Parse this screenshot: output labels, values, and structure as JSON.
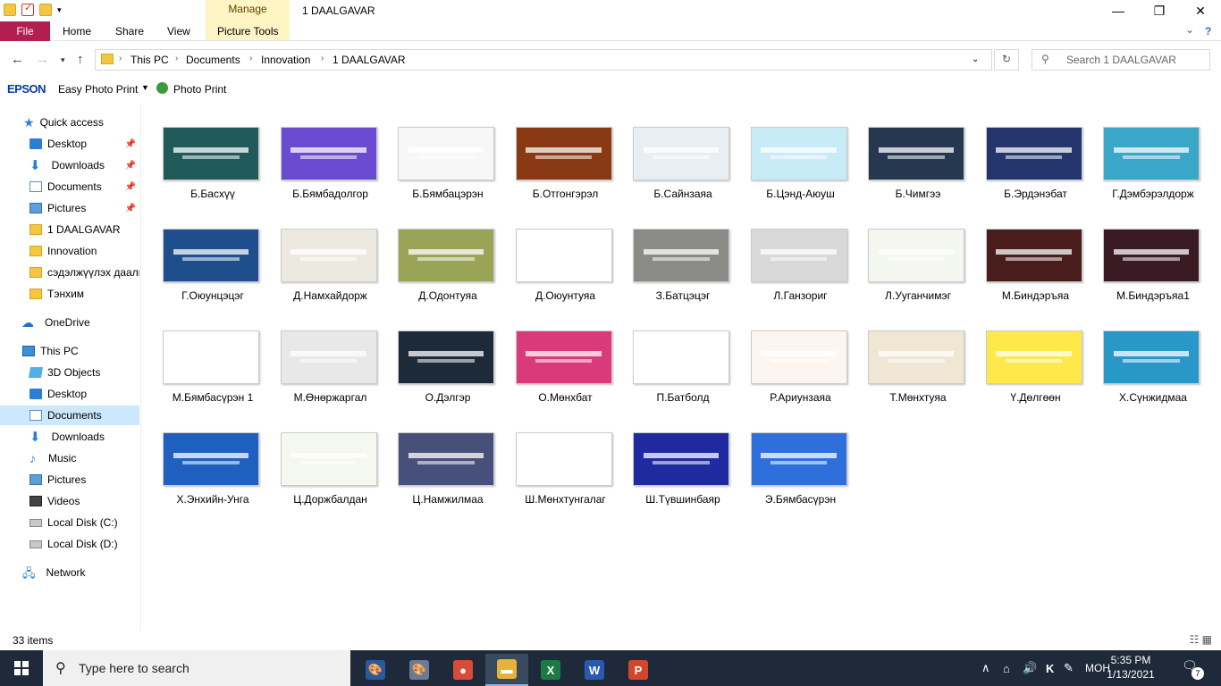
{
  "titlebar": {
    "title": "1 DAALGAVAR",
    "manage_tab": "Manage",
    "minimize": "—",
    "maximize": "❐",
    "close": "✕"
  },
  "ribbon": {
    "tabs": [
      "File",
      "Home",
      "Share",
      "View",
      "Picture Tools"
    ],
    "expand": "⌄",
    "help": "?"
  },
  "address": {
    "crumbs": [
      "This PC",
      "Documents",
      "Innovation",
      "1 DAALGAVAR"
    ],
    "search_placeholder": "Search 1 DAALGAVAR"
  },
  "epson": {
    "brand": "EPSON",
    "easy_photo_print": "Easy Photo Print",
    "photo_print": "Photo Print"
  },
  "sidebar": {
    "items": [
      {
        "label": "Quick access",
        "icon": "star-icon"
      },
      {
        "label": "Desktop",
        "icon": "desktop-icon",
        "pinned": true
      },
      {
        "label": "Downloads",
        "icon": "download-icon",
        "pinned": true
      },
      {
        "label": "Documents",
        "icon": "documents-icon",
        "pinned": true
      },
      {
        "label": "Pictures",
        "icon": "pictures-icon",
        "pinned": true
      },
      {
        "label": "1 DAALGAVAR",
        "icon": "folder-icon"
      },
      {
        "label": "Innovation",
        "icon": "folder-icon"
      },
      {
        "label": "сэдэлжүүлэх даалг",
        "icon": "folder-icon"
      },
      {
        "label": "Тэнхим",
        "icon": "folder-icon"
      },
      {
        "label": "OneDrive",
        "icon": "cloud-icon"
      },
      {
        "label": "This PC",
        "icon": "computer-icon"
      },
      {
        "label": "3D Objects",
        "icon": "3d-objects-icon"
      },
      {
        "label": "Desktop",
        "icon": "desktop-icon"
      },
      {
        "label": "Documents",
        "icon": "documents-icon",
        "selected": true
      },
      {
        "label": "Downloads",
        "icon": "download-icon"
      },
      {
        "label": "Music",
        "icon": "music-icon"
      },
      {
        "label": "Pictures",
        "icon": "pictures-icon"
      },
      {
        "label": "Videos",
        "icon": "video-icon"
      },
      {
        "label": "Local Disk (C:)",
        "icon": "disk-icon"
      },
      {
        "label": "Local Disk (D:)",
        "icon": "disk-icon"
      },
      {
        "label": "Network",
        "icon": "network-icon"
      }
    ]
  },
  "files": [
    {
      "name": "Б.Басхүү",
      "color": "#1f5a58"
    },
    {
      "name": "Б.Бямбадолгор",
      "color": "#6a4bd0"
    },
    {
      "name": "Б.Бямбацэрэн",
      "color": "#f7f7f7"
    },
    {
      "name": "Б.Отгонгэрэл",
      "color": "#8a3a12"
    },
    {
      "name": "Б.Сайнзаяа",
      "color": "#e8eef2"
    },
    {
      "name": "Б.Цэнд-Аюуш",
      "color": "#c7ecf7"
    },
    {
      "name": "Б.Чимгээ",
      "color": "#26384f"
    },
    {
      "name": "Б.Эрдэнэбат",
      "color": "#24356e"
    },
    {
      "name": "Г.Дэмбэрэлдорж",
      "color": "#3aa6c8"
    },
    {
      "name": "Г.Оюунцэцэг",
      "color": "#1e4f8c"
    },
    {
      "name": "Д.Намхайдорж",
      "color": "#eceae0"
    },
    {
      "name": "Д.Одонтуяа",
      "color": "#9aa456"
    },
    {
      "name": "Д.Оюунтуяа",
      "color": "#ffffff"
    },
    {
      "name": "З.Батцэцэг",
      "color": "#8a8a86"
    },
    {
      "name": "Л.Ганзориг",
      "color": "#d8d8d8"
    },
    {
      "name": "Л.Ууганчимэг",
      "color": "#f3f7f0"
    },
    {
      "name": "М.Биндэръяа",
      "color": "#4a1d1d"
    },
    {
      "name": "М.Биндэръяа1",
      "color": "#3a1b24"
    },
    {
      "name": "М.Бямбасүрэн 1",
      "color": "#ffffff"
    },
    {
      "name": "М.Өнөржаргал",
      "color": "#e8e8e8"
    },
    {
      "name": "О.Дэлгэр",
      "color": "#1d2a3a"
    },
    {
      "name": "О.Мөнхбат",
      "color": "#d83a7a"
    },
    {
      "name": "П.Батболд",
      "color": "#ffffff"
    },
    {
      "name": "Р.Ариунзаяа",
      "color": "#fdf6f0"
    },
    {
      "name": "Т.Мөнхтуяа",
      "color": "#efe6d4"
    },
    {
      "name": "Ү.Дөлгөөн",
      "color": "#ffe84a"
    },
    {
      "name": "Х.Сүнжидмаа",
      "color": "#2a97c9"
    },
    {
      "name": "Х.Энхийн-Унга",
      "color": "#1e5fbf"
    },
    {
      "name": "Ц.Доржбалдан",
      "color": "#f4f8ee"
    },
    {
      "name": "Ц.Намжилмаа",
      "color": "#47507a"
    },
    {
      "name": "Ш.Мөнхтунгалаг",
      "color": "#ffffff"
    },
    {
      "name": "Ш.Түвшинбаяр",
      "color": "#1f2aa0"
    },
    {
      "name": "Э.Бямбасүрэн",
      "color": "#2e6fdc"
    }
  ],
  "status": {
    "count": "33 items",
    "views": "☷ ▦"
  },
  "taskbar": {
    "search_placeholder": "Type here to search",
    "apps": [
      {
        "name": "paint-app-icon",
        "glyph": "🎨",
        "color": "#2a5a9c",
        "active": false
      },
      {
        "name": "palette-app-icon",
        "glyph": "🎨",
        "color": "#6a7a9a",
        "active": false
      },
      {
        "name": "chrome-icon",
        "glyph": "●",
        "color": "#d84a3a",
        "active": false
      },
      {
        "name": "file-explorer-icon",
        "glyph": "▬",
        "color": "#e8b23a",
        "active": true
      },
      {
        "name": "excel-icon",
        "glyph": "X",
        "color": "#1e7a44",
        "active": false
      },
      {
        "name": "word-icon",
        "glyph": "W",
        "color": "#2a5ab0",
        "active": false
      },
      {
        "name": "powerpoint-icon",
        "glyph": "P",
        "color": "#d2462c",
        "active": false
      }
    ],
    "tray": {
      "chevron": "∧",
      "speaker": "🔊",
      "lang": "МОН",
      "time": "5:35 PM",
      "date": "1/13/2021",
      "notifications": "7"
    }
  }
}
